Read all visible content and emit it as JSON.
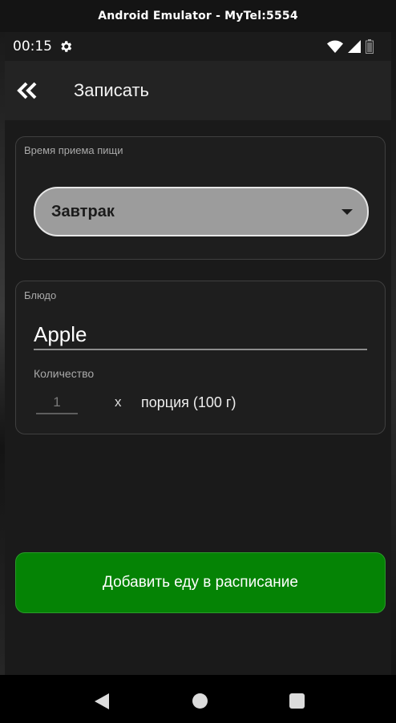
{
  "emulator": {
    "title": "Android Emulator - MyTel:5554"
  },
  "status_bar": {
    "time": "00:15"
  },
  "app_bar": {
    "title": "Записать"
  },
  "meal_section": {
    "label": "Время приема пищи",
    "selected_value": "Завтрак"
  },
  "dish_section": {
    "label": "Блюдо",
    "dish_value": "Apple",
    "quantity_label": "Количество",
    "quantity_value": "1",
    "multiplier": "x",
    "portion": "порция (100 г)"
  },
  "add_button": {
    "label": "Добавить еду в расписание"
  },
  "colors": {
    "accent_green": "#058305",
    "dropdown_bg": "#9c9c9c",
    "background": "#1a1a1a"
  },
  "icons": {
    "back": "double-chevron-left-icon",
    "settings": "gear-icon",
    "wifi": "wifi-icon",
    "signal": "signal-icon",
    "battery": "battery-icon",
    "nav_back": "triangle-back-icon",
    "nav_home": "circle-home-icon",
    "nav_recents": "square-recents-icon"
  }
}
